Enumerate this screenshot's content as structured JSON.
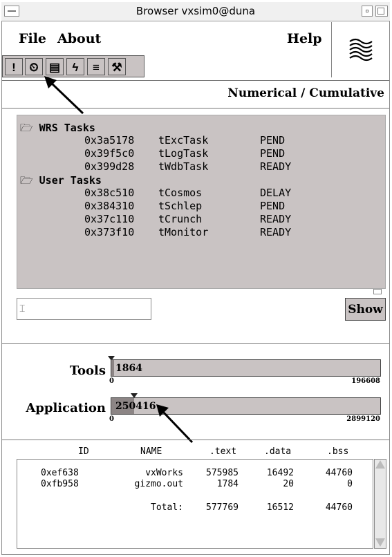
{
  "window": {
    "title": "Browser vxsim0@duna"
  },
  "menu": {
    "file": "File",
    "about": "About",
    "help": "Help"
  },
  "toolbar": {
    "buttons": [
      {
        "icon": "exclamation-icon",
        "glyph": "!"
      },
      {
        "icon": "clock-icon",
        "glyph": "⏲"
      },
      {
        "icon": "database-icon",
        "glyph": "▤"
      },
      {
        "icon": "lightning-icon",
        "glyph": "ϟ"
      },
      {
        "icon": "bars-icon",
        "glyph": "≡"
      },
      {
        "icon": "tools-icon",
        "glyph": "⚒"
      }
    ]
  },
  "mode_label": "Numerical / Cumulative",
  "tasks": {
    "groups": [
      {
        "name": "WRS Tasks",
        "items": [
          {
            "id": "0x3a5178",
            "name": "tExcTask",
            "state": "PEND"
          },
          {
            "id": "0x39f5c0",
            "name": "tLogTask",
            "state": "PEND"
          },
          {
            "id": "0x399d28",
            "name": "tWdbTask",
            "state": "READY"
          }
        ]
      },
      {
        "name": "User Tasks",
        "items": [
          {
            "id": "0x38c510",
            "name": "tCosmos",
            "state": "DELAY"
          },
          {
            "id": "0x384310",
            "name": "tSchlep",
            "state": "PEND"
          },
          {
            "id": "0x37c110",
            "name": "tCrunch",
            "state": "READY"
          },
          {
            "id": "0x373f10",
            "name": "tMonitor",
            "state": "READY"
          }
        ]
      }
    ]
  },
  "search": {
    "value": ""
  },
  "show_button": "Show",
  "memory": {
    "tools": {
      "label": "Tools",
      "value": "1864",
      "min": "0",
      "max": "196608",
      "fraction": 0.0095
    },
    "application": {
      "label": "Application",
      "value": "250416",
      "min": "0",
      "max": "2899120",
      "fraction": 0.086
    }
  },
  "modules": {
    "headers": [
      "ID",
      "NAME",
      ".text",
      ".data",
      ".bss"
    ],
    "rows": [
      [
        "0xef638",
        "vxWorks",
        "575985",
        "16492",
        "44760"
      ],
      [
        "0xfb958",
        "gizmo.out",
        "1784",
        "20",
        "0"
      ]
    ],
    "total": {
      "label": "Total:",
      "text": "577769",
      "data": "16512",
      "bss": "44760"
    }
  }
}
